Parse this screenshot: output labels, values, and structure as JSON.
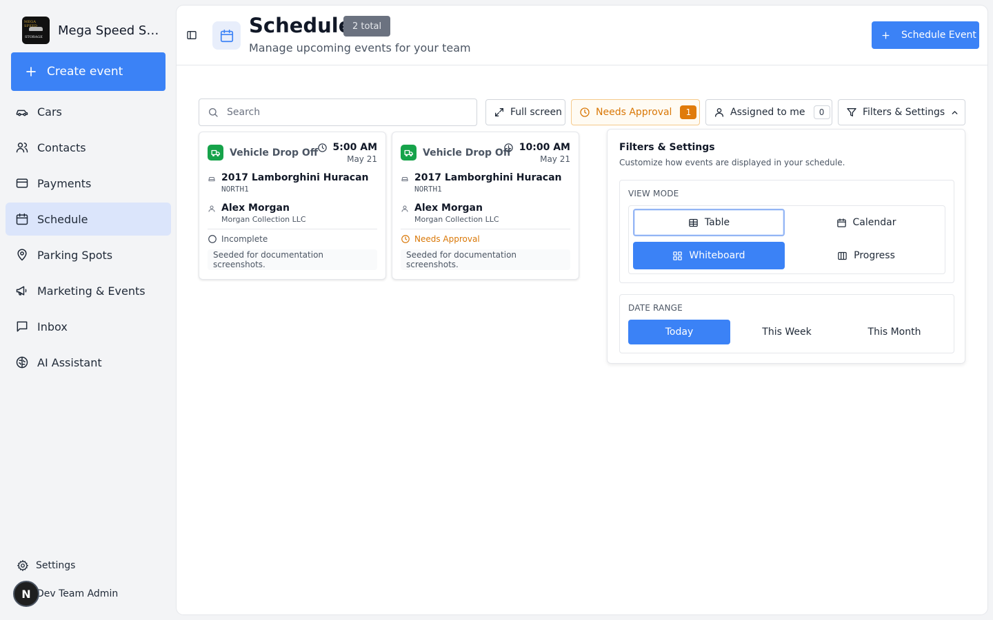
{
  "brand": {
    "name": "Mega Speed Storage",
    "logo_top": "MEGA SPEED",
    "logo_bottom": "STORAGE"
  },
  "sidebar": {
    "create_label": "Create event",
    "items": [
      {
        "label": "Cars",
        "icon": "car-icon"
      },
      {
        "label": "Contacts",
        "icon": "users-icon"
      },
      {
        "label": "Payments",
        "icon": "credit-card-icon"
      },
      {
        "label": "Schedule",
        "icon": "calendar-icon",
        "active": true
      },
      {
        "label": "Parking Spots",
        "icon": "map-pin-icon"
      },
      {
        "label": "Marketing & Events",
        "icon": "megaphone-icon"
      },
      {
        "label": "Inbox",
        "icon": "message-square-icon"
      },
      {
        "label": "AI Assistant",
        "icon": "brain-icon"
      }
    ],
    "settings_label": "Settings",
    "user_name": "Dev Team Admin",
    "user_initial": "N"
  },
  "header": {
    "title": "Schedule",
    "badge": "2 total",
    "subtitle": "Manage upcoming events for your team",
    "schedule_btn": "Schedule Event"
  },
  "toolbar": {
    "search_placeholder": "Search",
    "fullscreen_label": "Full screen",
    "needs_approval_label": "Needs Approval",
    "needs_approval_count": "1",
    "assigned_label": "Assigned to me",
    "assigned_count": "0",
    "filters_label": "Filters & Settings"
  },
  "cards": [
    {
      "type": "Vehicle Drop Off",
      "time": "5:00 AM",
      "date": "May 21",
      "vehicle": "2017 Lamborghini Huracan",
      "plate": "NORTH1",
      "contact": "Alex Morgan",
      "company": "Morgan Collection LLC",
      "status": "Incomplete",
      "note": "Seeded for documentation screenshots."
    },
    {
      "type": "Vehicle Drop Off",
      "time": "10:00 AM",
      "date": "May 21",
      "vehicle": "2017 Lamborghini Huracan",
      "plate": "NORTH1",
      "contact": "Alex Morgan",
      "company": "Morgan Collection LLC",
      "status": "Needs Approval",
      "note": "Seeded for documentation screenshots."
    }
  ],
  "filters": {
    "title": "Filters & Settings",
    "subtitle": "Customize how events are displayed in your schedule.",
    "view_mode_label": "VIEW MODE",
    "view_modes": [
      "Table",
      "Calendar",
      "Whiteboard",
      "Progress"
    ],
    "selected_view_mode": "Whiteboard",
    "date_range_label": "DATE RANGE",
    "date_ranges": [
      "Today",
      "This Week",
      "This Month"
    ],
    "selected_date_range": "Today"
  },
  "colors": {
    "accent": "#3b82f6",
    "warning": "#d97706",
    "success": "#16a34a"
  }
}
